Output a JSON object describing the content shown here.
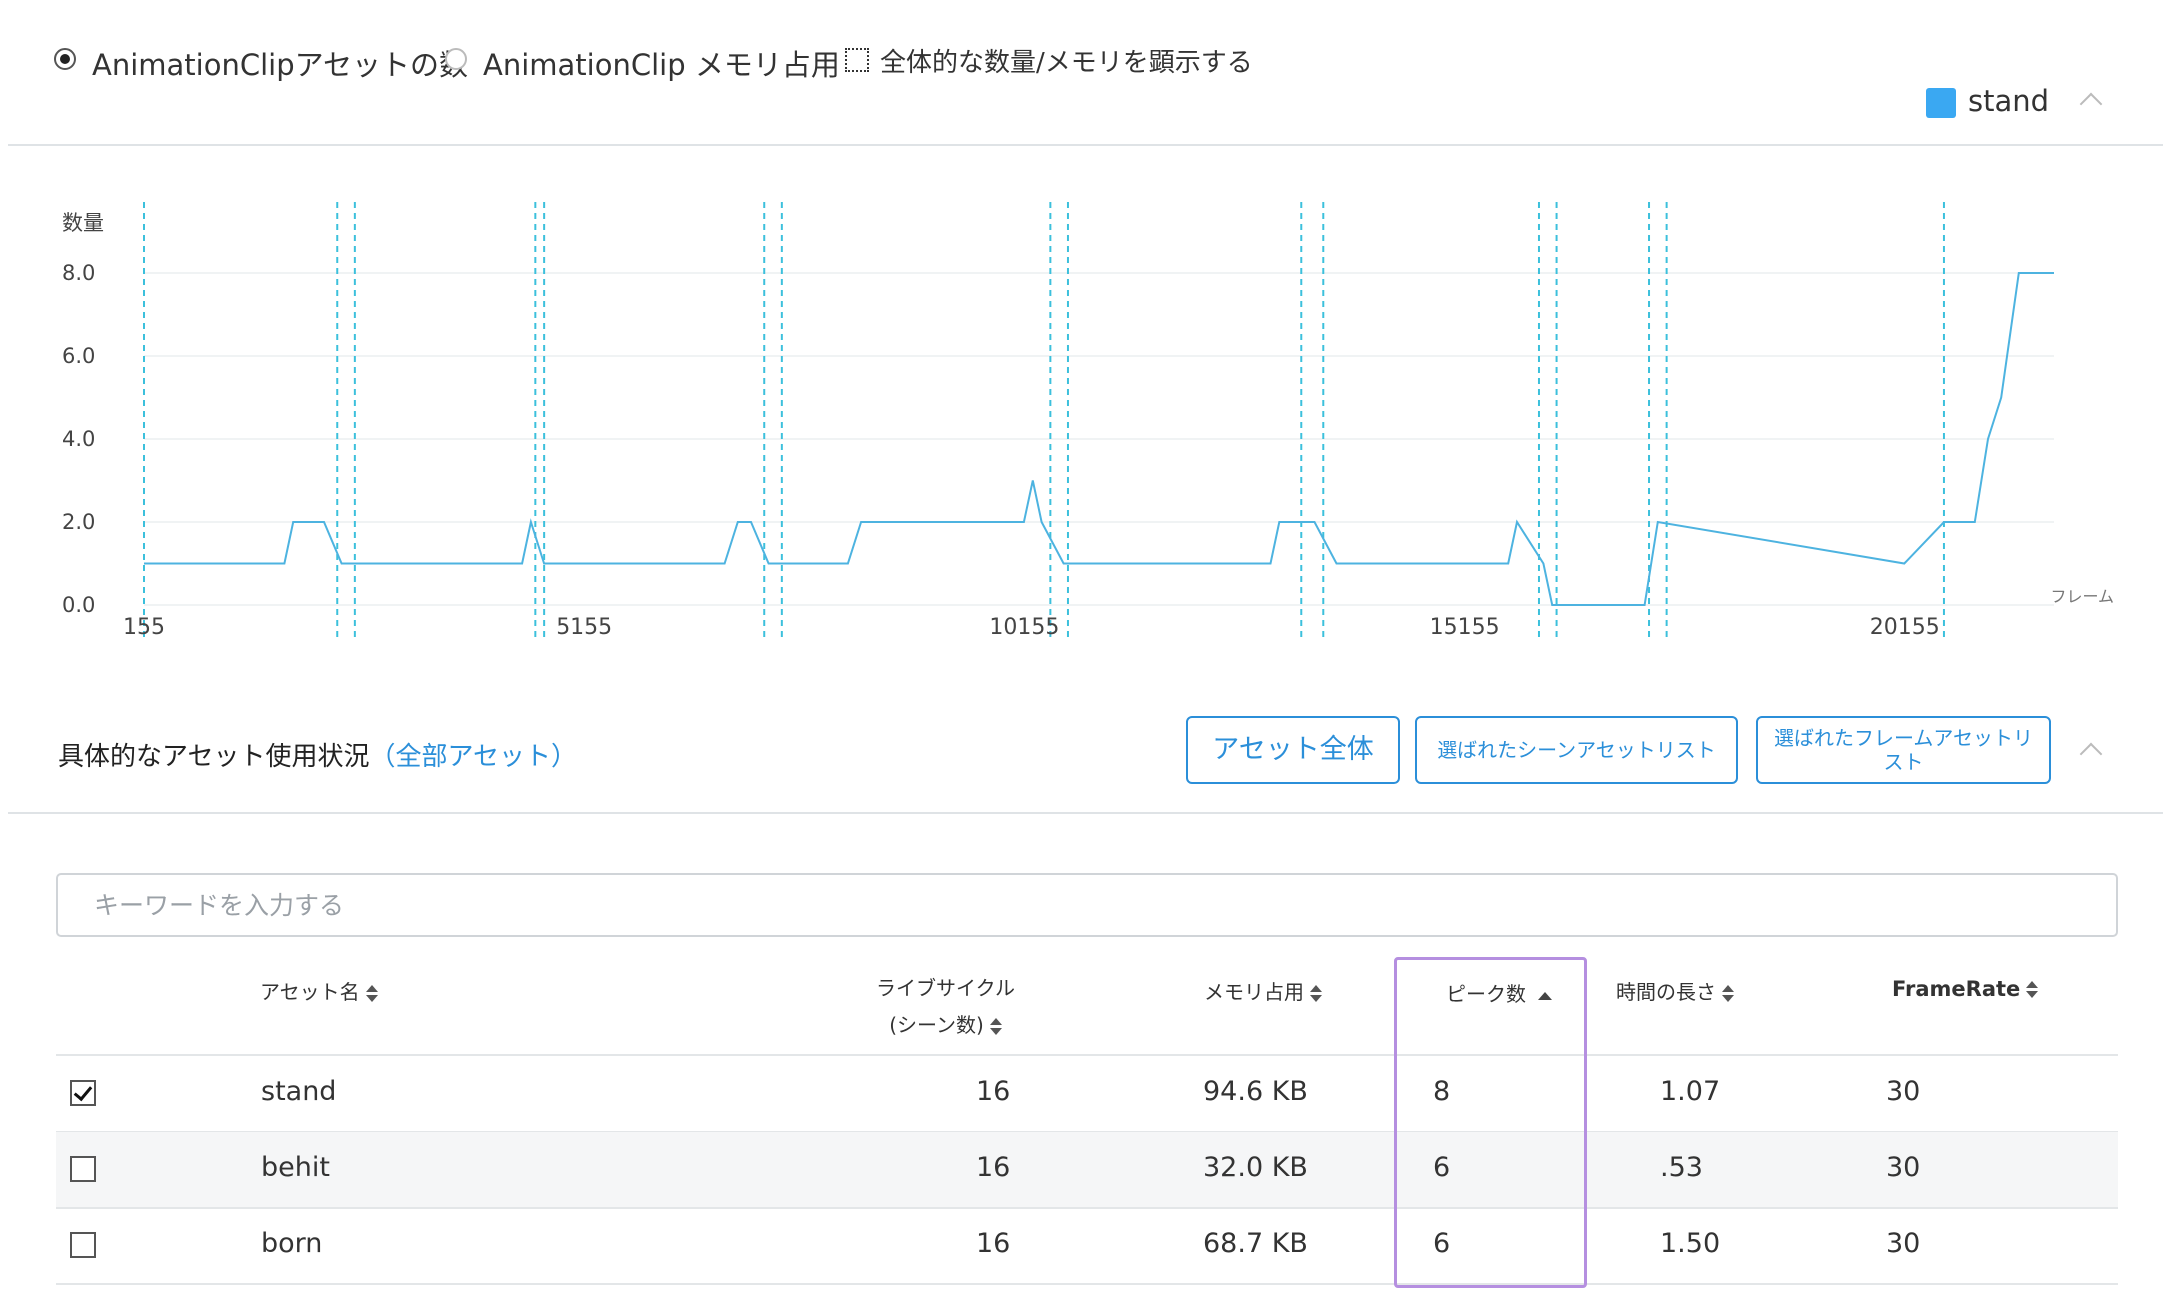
{
  "options": {
    "radio_count_label": "AnimationClipアセットの数",
    "radio_memory_label": "AnimationClip メモリ占用",
    "selected": "count",
    "checkbox_label": "全体的な数量/メモリを顕示する",
    "checkbox_checked": false
  },
  "legend": {
    "label": "stand",
    "color": "#3aa8f2"
  },
  "chart_data": {
    "type": "line",
    "ylabel": "数量",
    "xlabel": "フレーム",
    "ylim": [
      0,
      8
    ],
    "yticks": [
      "0.0",
      "2.0",
      "4.0",
      "6.0",
      "8.0"
    ],
    "xticks": [
      "155",
      "5155",
      "10155",
      "15155",
      "20155"
    ],
    "color": "#4db3e0",
    "series": [
      {
        "x": [
          155,
          1750,
          1850,
          2200,
          2400,
          4450,
          4550,
          4700,
          6750,
          6900,
          7050,
          7250,
          8150,
          8300,
          10150,
          10250,
          10350,
          10600,
          12950,
          13050,
          13450,
          13700,
          15650,
          15750,
          16050,
          16150,
          17200,
          17350,
          20150,
          20600,
          20950,
          21100,
          21250,
          21450,
          21850
        ],
        "y": [
          1,
          1,
          2,
          2,
          1,
          1,
          2,
          1,
          1,
          2,
          2,
          1,
          1,
          2,
          2,
          3,
          2,
          1,
          1,
          2,
          2,
          1,
          1,
          2,
          1,
          0,
          0,
          2,
          1,
          2,
          2,
          4,
          5,
          8,
          8
        ]
      }
    ],
    "markers": [
      155,
      2350,
      2550,
      4600,
      4700,
      7200,
      7400,
      10450,
      10650,
      13300,
      13550,
      16000,
      16200,
      17250,
      17450,
      20600
    ]
  },
  "section": {
    "title": "具体的なアセット使用状況",
    "link": "（全部アセット）",
    "btn_all": "アセット全体",
    "btn_scene": "選ばれたシーンアセットリスト",
    "btn_frame": "選ばれたフレームアセットリスト"
  },
  "search": {
    "placeholder": "キーワードを入力する",
    "value": ""
  },
  "table": {
    "headers": {
      "name": "アセット名",
      "lifecycle_1": "ライブサイクル",
      "lifecycle_2": "(シーン数)",
      "memory": "メモリ占用",
      "peak": "ピーク数",
      "duration": "時間の長さ",
      "framerate": "FrameRate"
    },
    "rows": [
      {
        "checked": true,
        "name": "stand",
        "lifecycle": "16",
        "memory": "94.6 KB",
        "peak": "8",
        "duration": "1.07",
        "framerate": "30"
      },
      {
        "checked": false,
        "name": "behit",
        "lifecycle": "16",
        "memory": "32.0 KB",
        "peak": "6",
        "duration": ".53",
        "framerate": "30"
      },
      {
        "checked": false,
        "name": "born",
        "lifecycle": "16",
        "memory": "68.7 KB",
        "peak": "6",
        "duration": "1.50",
        "framerate": "30"
      }
    ]
  }
}
